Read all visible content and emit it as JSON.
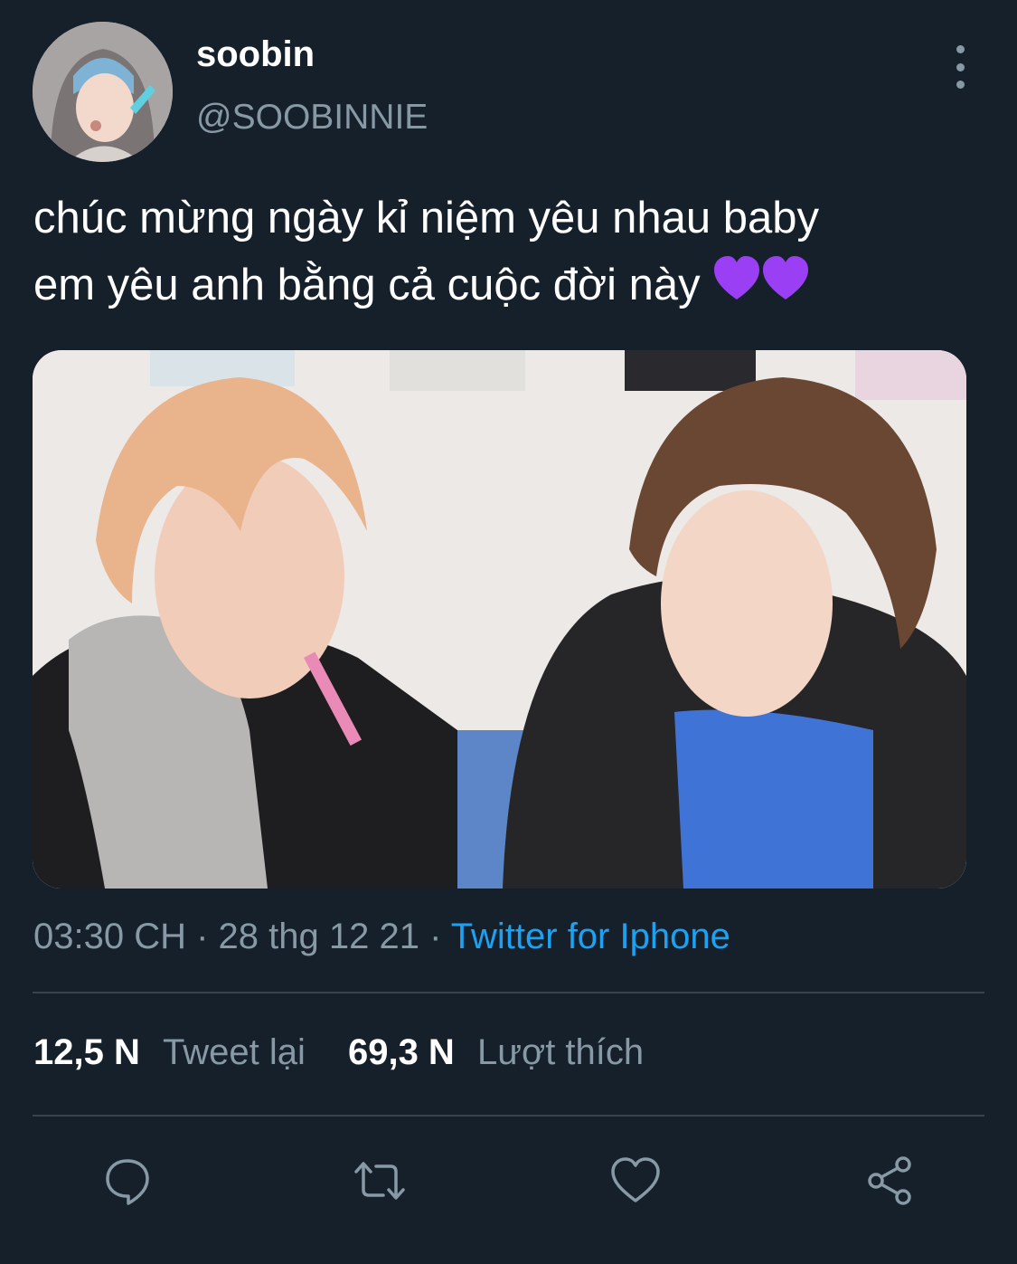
{
  "user": {
    "display_name": "soobin",
    "handle": "@SOOBINNIE",
    "avatar_icon": "profile-photo"
  },
  "tweet": {
    "text_line1": "chúc mừng ngày kỉ niệm yêu nhau baby",
    "text_line2": "em yêu anh bằng cả cuộc đời này",
    "emoji": "purple-heart x2",
    "media_icon": "photo"
  },
  "meta": {
    "time": "03:30 CH",
    "separator1": " · ",
    "date": "28 thg 12 21",
    "separator2": " · ",
    "source": "Twitter for Iphone"
  },
  "stats": {
    "retweets_count": "12,5 N",
    "retweets_label": "Tweet lại",
    "likes_count": "69,3 N",
    "likes_label": "Lượt thích"
  },
  "actions": [
    {
      "icon": "reply-icon"
    },
    {
      "icon": "retweet-icon"
    },
    {
      "icon": "like-icon"
    },
    {
      "icon": "share-icon"
    }
  ],
  "colors": {
    "background": "#15202b",
    "secondary_text": "#8899a6",
    "link": "#1da1f2",
    "divider": "#38444d",
    "emoji_heart": "#9b3ff5"
  }
}
